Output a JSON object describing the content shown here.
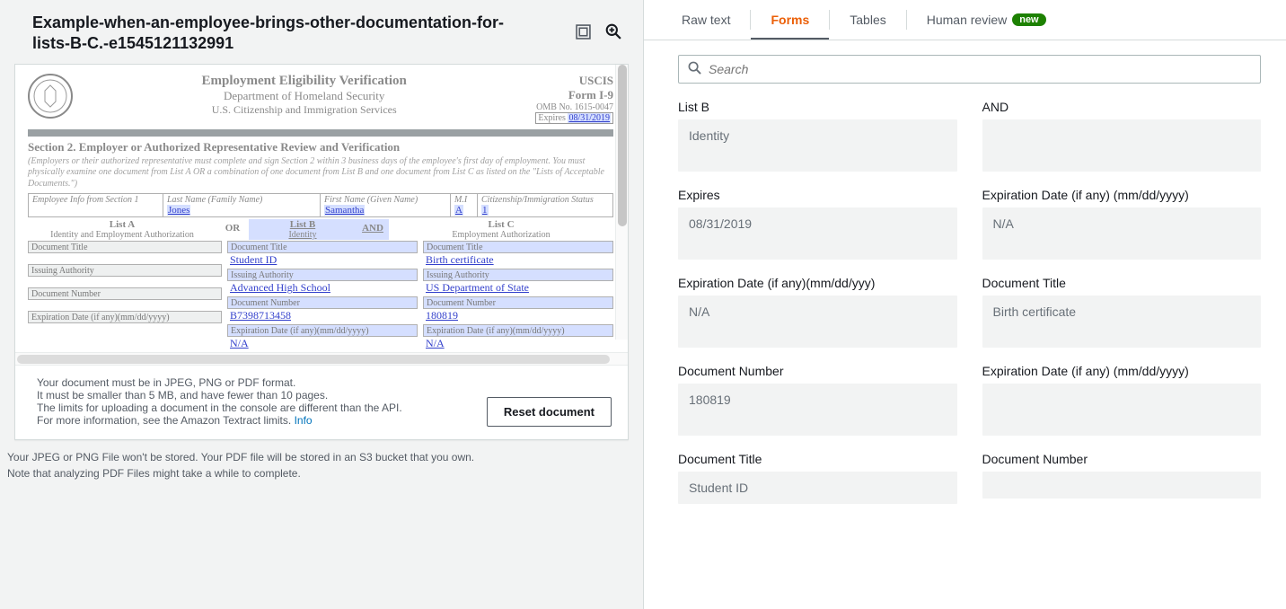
{
  "document_title": "Example-when-an-employee-brings-other-documentation-for-lists-B-C.-e1545121132991",
  "form": {
    "header_line1": "Employment Eligibility Verification",
    "header_line2": "Department of Homeland Security",
    "header_line3": "U.S. Citizenship and Immigration Services",
    "uscis": "USCIS",
    "form_no": "Form I-9",
    "omb": "OMB No. 1615-0047",
    "expires_lbl": "Expires",
    "expires_val": "08/31/2019",
    "section2_title": "Section 2. Employer or Authorized Representative Review and Verification",
    "section2_note": "(Employers or their authorized representative must complete and sign Section 2 within 3 business days of the employee's first day of employment. You must physically examine one document from List A OR a combination of one document from List B and one document from List C as listed on the \"Lists of Acceptable Documents.\")",
    "emp_info_lbl": "Employee Info from Section 1",
    "last_name_lbl": "Last Name (Family Name)",
    "last_name": "Jones",
    "first_name_lbl": "First Name (Given Name)",
    "first_name": "Samantha",
    "mi_lbl": "M.I",
    "mi": "A",
    "cis_lbl": "Citizenship/Immigration Status",
    "cis": "1",
    "list_a": "List A",
    "list_a_sub": "Identity and Employment Authorization",
    "or": "OR",
    "list_b": "List B",
    "list_b_sub": "Identity",
    "and": "AND",
    "list_c": "List C",
    "list_c_sub": "Employment Authorization",
    "doc_title_lbl": "Document Title",
    "issuing_lbl": "Issuing Authority",
    "doc_num_lbl": "Document Number",
    "exp_date_lbl": "Expiration Date (if any)(mm/dd/yyyy)",
    "b_doc_title": "Student ID",
    "b_issuing": "Advanced High School",
    "b_doc_num": "B7398713458",
    "b_exp": "N/A",
    "c_doc_title": "Birth certificate",
    "c_issuing": "US Department of State",
    "c_doc_num": "180819",
    "c_exp": "N/A"
  },
  "footer": {
    "l1": "Your document must be in JPEG, PNG or PDF format.",
    "l2": "It must be smaller than 5 MB, and have fewer than 10 pages.",
    "l3": "The limits for uploading a document in the console are different than the API.",
    "l4": "For more information, see the Amazon Textract limits. ",
    "info": "Info",
    "reset": "Reset document"
  },
  "storage_note": {
    "l1": "Your JPEG or PNG File won't be stored. Your PDF file will be stored in an S3 bucket that you own.",
    "l2": "Note that analyzing PDF Files might take a while to complete."
  },
  "tabs": {
    "raw": "Raw text",
    "forms": "Forms",
    "tables": "Tables",
    "human": "Human review",
    "new": "new"
  },
  "search_placeholder": "Search",
  "kv": [
    {
      "k": "List B",
      "v": "Identity"
    },
    {
      "k": "AND",
      "v": ""
    },
    {
      "k": "Expires",
      "v": "08/31/2019"
    },
    {
      "k": "Expiration Date (if any) (mm/dd/yyyy)",
      "v": "N/A"
    },
    {
      "k": "Expiration Date (if any)(mm/dd/yyy)",
      "v": "N/A"
    },
    {
      "k": "Document Title",
      "v": "Birth certificate"
    },
    {
      "k": "Document Number",
      "v": "180819"
    },
    {
      "k": "Expiration Date (if any) (mm/dd/yyyy)",
      "v": ""
    },
    {
      "k": "Document Title",
      "v": "Student ID"
    },
    {
      "k": "Document Number",
      "v": ""
    }
  ]
}
